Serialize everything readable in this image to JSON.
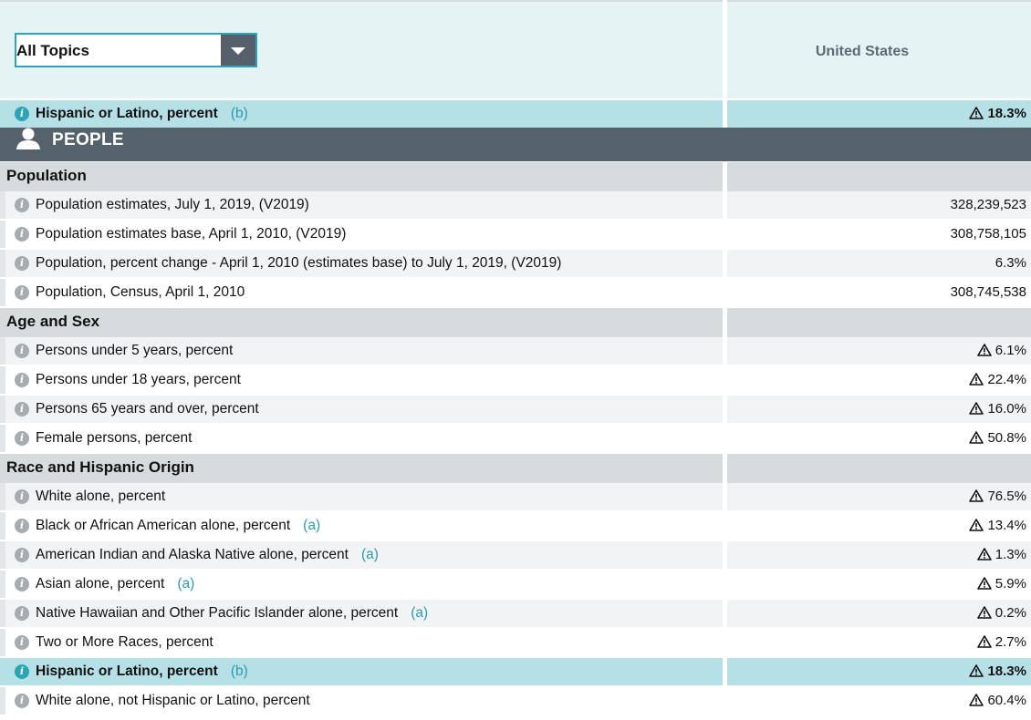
{
  "filter": {
    "selected": "All Topics"
  },
  "column_header": "United States",
  "pinned_row": {
    "label": "Hispanic or Latino, percent",
    "note": "(b)",
    "value": "18.3%"
  },
  "banner": {
    "label": "PEOPLE"
  },
  "sections": [
    {
      "title": "Population",
      "rows": [
        {
          "label": "Population estimates, July 1, 2019,  (V2019)",
          "note": "",
          "value": "328,239,523"
        },
        {
          "label": "Population estimates base, April 1, 2010,  (V2019)",
          "note": "",
          "value": "308,758,105"
        },
        {
          "label": "Population, percent change - April 1, 2010 (estimates base) to July 1, 2019,  (V2019)",
          "note": "",
          "value": "6.3%"
        },
        {
          "label": "Population, Census, April 1, 2010",
          "note": "",
          "value": "308,745,538"
        }
      ]
    },
    {
      "title": "Age and Sex",
      "rows": [
        {
          "label": "Persons under 5 years, percent",
          "note": "",
          "value": "6.1%"
        },
        {
          "label": "Persons under 18 years, percent",
          "note": "",
          "value": "22.4%"
        },
        {
          "label": "Persons 65 years and over, percent",
          "note": "",
          "value": "16.0%"
        },
        {
          "label": "Female persons, percent",
          "note": "",
          "value": "50.8%"
        }
      ]
    },
    {
      "title": "Race and Hispanic Origin",
      "rows": [
        {
          "label": "White alone, percent",
          "note": "",
          "value": "76.5%"
        },
        {
          "label": "Black or African American alone, percent",
          "note": "(a)",
          "value": "13.4%"
        },
        {
          "label": "American Indian and Alaska Native alone, percent",
          "note": "(a)",
          "value": "1.3%"
        },
        {
          "label": "Asian alone, percent",
          "note": "(a)",
          "value": "5.9%"
        },
        {
          "label": "Native Hawaiian and Other Pacific Islander alone, percent",
          "note": "(a)",
          "value": "0.2%"
        },
        {
          "label": "Two or More Races, percent",
          "note": "",
          "value": "2.7%"
        },
        {
          "label": "Hispanic or Latino, percent",
          "note": "(b)",
          "value": "18.3%"
        },
        {
          "label": "White alone, not Hispanic or Latino, percent",
          "note": "",
          "value": "60.4%"
        }
      ]
    }
  ],
  "icons": {
    "info": "info-icon",
    "warning": "warning-triangle-icon",
    "person": "person-icon"
  },
  "colors": {
    "accent": "#2aa4b6",
    "highlight": "#b4e0e6",
    "banner": "#55626c",
    "section": "#d6dbde",
    "header": "#e5f3f5"
  }
}
